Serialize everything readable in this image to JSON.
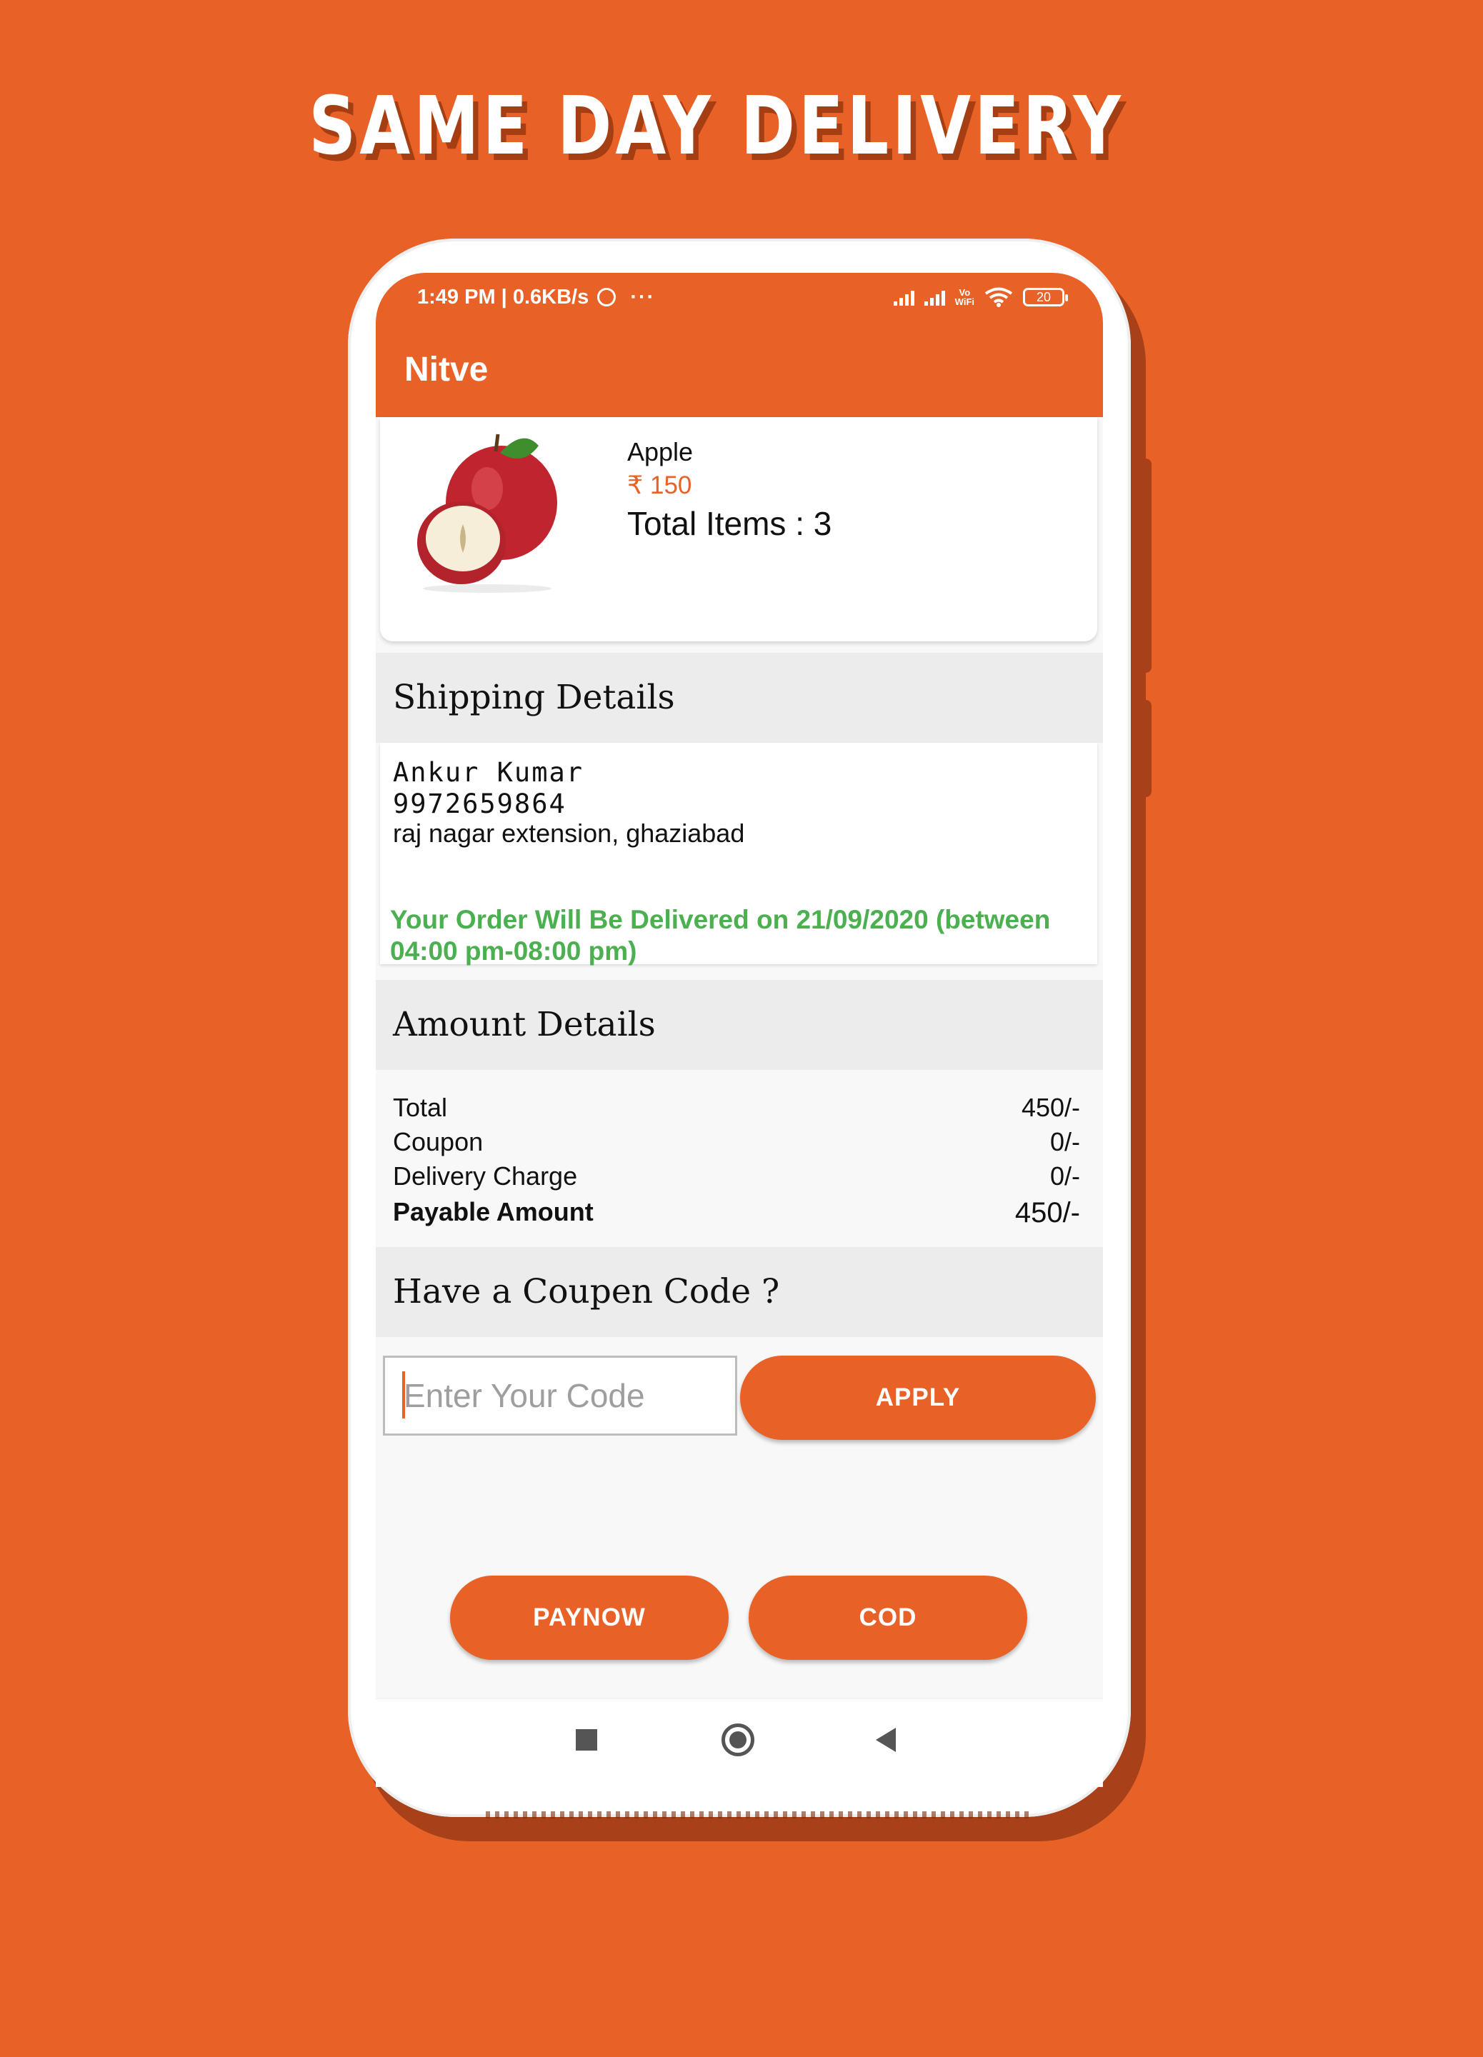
{
  "headline": "SAME DAY DELIVERY",
  "status_bar": {
    "time": "1:49 PM | 0.6KB/s",
    "more": "···",
    "vowifi_top": "Vo",
    "vowifi_bottom": "WiFi",
    "battery": "20"
  },
  "app": {
    "title": "Nitve"
  },
  "product": {
    "name": "Apple",
    "price": "₹ 150",
    "total_items": "Total Items : 3",
    "image_icon": "apple-image"
  },
  "shipping": {
    "header": "Shipping Details",
    "name": "Ankur Kumar",
    "phone": "9972659864",
    "address": "raj nagar extension, ghaziabad",
    "delivery_note": "Your Order Will Be Delivered on 21/09/2020 (between 04:00 pm-08:00 pm)"
  },
  "amount": {
    "header": "Amount Details",
    "rows": [
      {
        "label": "Total",
        "value": "450/-"
      },
      {
        "label": "Coupon",
        "value": "0/-"
      },
      {
        "label": "Delivery Charge",
        "value": "0/-"
      },
      {
        "label": "Payable Amount",
        "value": "450/-"
      }
    ]
  },
  "coupon": {
    "header": "Have a Coupen Code ?",
    "placeholder": "Enter Your Code",
    "apply_label": "APPLY"
  },
  "actions": {
    "paynow_label": "PAYNOW",
    "cod_label": "COD"
  },
  "nav": {
    "icons": [
      "recents-square-icon",
      "home-circle-icon",
      "back-triangle-icon"
    ]
  },
  "colors": {
    "accent": "#E86126",
    "success": "#4CAF50",
    "section_bg": "#EDECEC"
  }
}
